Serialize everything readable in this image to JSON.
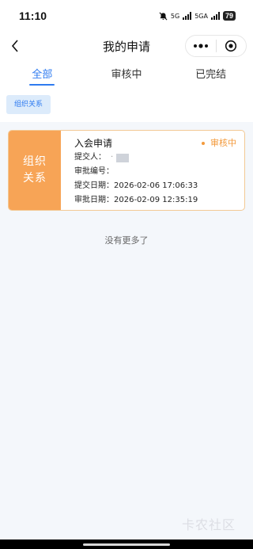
{
  "status_bar": {
    "time": "11:10",
    "net1": "5G",
    "net2": "5GA",
    "battery": "79"
  },
  "nav": {
    "title": "我的申请"
  },
  "tabs": [
    {
      "label": "全部",
      "active": true
    },
    {
      "label": "审核中",
      "active": false
    },
    {
      "label": "已完结",
      "active": false
    }
  ],
  "filter": {
    "chip_label": "组织关系"
  },
  "cards": [
    {
      "badge_line1": "组织",
      "badge_line2": "关系",
      "title": "入会申请",
      "status": "审核中",
      "submitter_label": "提交人：",
      "submitter_value": "·",
      "approval_no_label": "审批编号：",
      "approval_no_value": "",
      "submit_date_label": "提交日期：",
      "submit_date_value": "2026-02-06 17:06:33",
      "approve_date_label": "审批日期：",
      "approve_date_value": "2026-02-09 12:35:19"
    }
  ],
  "list_end_text": "没有更多了",
  "watermark": "卡农社区",
  "colors": {
    "accent": "#2f7bf0",
    "badge": "#f7a456",
    "status": "#f39a3c"
  }
}
